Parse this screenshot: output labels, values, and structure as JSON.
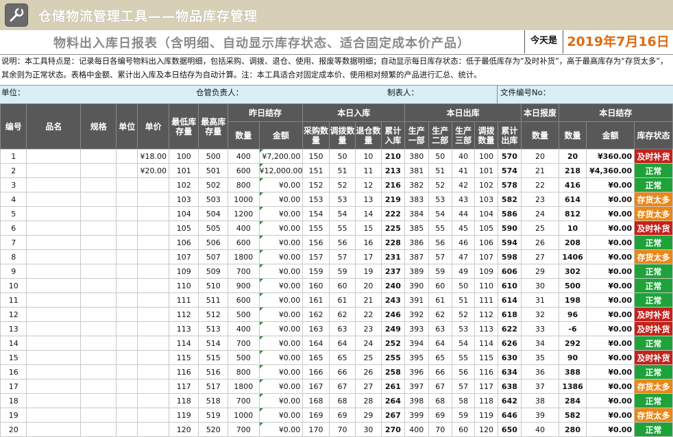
{
  "app": {
    "title": "仓储物流管理工具——物品库存管理",
    "icon": "wrench-icon"
  },
  "report": {
    "title": "物料出入库日报表（含明细、自动显示库存状态、适合固定成本价产品）",
    "today_label": "今天是",
    "today_value": "2019年7月16日"
  },
  "description": "说明：本工具特点是：记录每日各编号物料出入库数据明细，包括采购、调拨、退仓、使用、报废等数据明细；自动显示每日库存状态：低于最低库存为“及时补货”，高于最高库存为“存货太多”，其余则为正常状态。表格中金额、累计出入库及本日结存为自动计算。注：本工具适合对固定成本价、使用相对频繁的产品进行汇总、统计。",
  "info": {
    "unit": "单位：",
    "manager": "仓管负责人：",
    "maker": "制表人：",
    "doc_no": "文件编号No："
  },
  "headers": {
    "no": "编号",
    "name": "品名",
    "spec": "规格",
    "unit": "单位",
    "price": "单价",
    "min": "最低库存量",
    "max": "最高库存量",
    "yesterday": "昨日结存",
    "in": "本日入库",
    "out": "本日出库",
    "scrap": "本日报废",
    "today": "本日结存",
    "qty": "数量",
    "amount": "金额",
    "purchase": "采购数量",
    "transfer_in": "调拨数量",
    "return": "退仓数量",
    "in_total": "累计入库",
    "prod1": "生产一部",
    "prod2": "生产二部",
    "prod3": "生产三部",
    "transfer_out": "调拨数量",
    "out_total": "累计出库",
    "scrap_qty": "数量",
    "today_qty": "数量",
    "today_amount": "金额",
    "status": "库存状态"
  },
  "rows": [
    {
      "no": "1",
      "price": "¥18.00",
      "min": "100",
      "max": "500",
      "y_qty": "400",
      "y_amt": "¥7,200.00",
      "pur": "150",
      "tin": "50",
      "ret": "10",
      "in_tot": "210",
      "p1": "380",
      "p2": "50",
      "p3": "40",
      "tout": "100",
      "out_tot": "570",
      "scrap": "20",
      "t_qty": "20",
      "t_amt": "¥360.00",
      "status": "及时补货",
      "s": "low"
    },
    {
      "no": "2",
      "price": "¥20.00",
      "min": "101",
      "max": "501",
      "y_qty": "600",
      "y_amt": "¥12,000.00",
      "pur": "151",
      "tin": "51",
      "ret": "11",
      "in_tot": "213",
      "p1": "381",
      "p2": "51",
      "p3": "41",
      "tout": "101",
      "out_tot": "574",
      "scrap": "21",
      "t_qty": "218",
      "t_amt": "¥4,360.00",
      "status": "正常",
      "s": "ok"
    },
    {
      "no": "3",
      "price": "",
      "min": "102",
      "max": "502",
      "y_qty": "800",
      "y_amt": "¥0.00",
      "pur": "152",
      "tin": "52",
      "ret": "12",
      "in_tot": "216",
      "p1": "382",
      "p2": "52",
      "p3": "42",
      "tout": "102",
      "out_tot": "578",
      "scrap": "22",
      "t_qty": "416",
      "t_amt": "¥0.00",
      "status": "正常",
      "s": "ok"
    },
    {
      "no": "4",
      "price": "",
      "min": "103",
      "max": "503",
      "y_qty": "1000",
      "y_amt": "¥0.00",
      "pur": "153",
      "tin": "53",
      "ret": "13",
      "in_tot": "219",
      "p1": "383",
      "p2": "53",
      "p3": "43",
      "tout": "103",
      "out_tot": "582",
      "scrap": "23",
      "t_qty": "614",
      "t_amt": "¥0.00",
      "status": "存货太多",
      "s": "high"
    },
    {
      "no": "5",
      "price": "",
      "min": "104",
      "max": "504",
      "y_qty": "1200",
      "y_amt": "¥0.00",
      "pur": "154",
      "tin": "54",
      "ret": "14",
      "in_tot": "222",
      "p1": "384",
      "p2": "54",
      "p3": "44",
      "tout": "104",
      "out_tot": "586",
      "scrap": "24",
      "t_qty": "812",
      "t_amt": "¥0.00",
      "status": "存货太多",
      "s": "high"
    },
    {
      "no": "6",
      "price": "",
      "min": "105",
      "max": "505",
      "y_qty": "400",
      "y_amt": "¥0.00",
      "pur": "155",
      "tin": "55",
      "ret": "15",
      "in_tot": "225",
      "p1": "385",
      "p2": "55",
      "p3": "45",
      "tout": "105",
      "out_tot": "590",
      "scrap": "25",
      "t_qty": "10",
      "t_amt": "¥0.00",
      "status": "及时补货",
      "s": "low"
    },
    {
      "no": "7",
      "price": "",
      "min": "106",
      "max": "506",
      "y_qty": "600",
      "y_amt": "¥0.00",
      "pur": "156",
      "tin": "56",
      "ret": "16",
      "in_tot": "228",
      "p1": "386",
      "p2": "56",
      "p3": "46",
      "tout": "106",
      "out_tot": "594",
      "scrap": "26",
      "t_qty": "208",
      "t_amt": "¥0.00",
      "status": "正常",
      "s": "ok"
    },
    {
      "no": "8",
      "price": "",
      "min": "107",
      "max": "507",
      "y_qty": "1800",
      "y_amt": "¥0.00",
      "pur": "157",
      "tin": "57",
      "ret": "17",
      "in_tot": "231",
      "p1": "387",
      "p2": "57",
      "p3": "47",
      "tout": "107",
      "out_tot": "598",
      "scrap": "27",
      "t_qty": "1406",
      "t_amt": "¥0.00",
      "status": "存货太多",
      "s": "high"
    },
    {
      "no": "9",
      "price": "",
      "min": "109",
      "max": "509",
      "y_qty": "700",
      "y_amt": "¥0.00",
      "pur": "159",
      "tin": "59",
      "ret": "19",
      "in_tot": "237",
      "p1": "389",
      "p2": "59",
      "p3": "49",
      "tout": "109",
      "out_tot": "606",
      "scrap": "29",
      "t_qty": "302",
      "t_amt": "¥0.00",
      "status": "正常",
      "s": "ok"
    },
    {
      "no": "10",
      "price": "",
      "min": "110",
      "max": "510",
      "y_qty": "900",
      "y_amt": "¥0.00",
      "pur": "160",
      "tin": "60",
      "ret": "20",
      "in_tot": "240",
      "p1": "390",
      "p2": "60",
      "p3": "50",
      "tout": "110",
      "out_tot": "610",
      "scrap": "30",
      "t_qty": "500",
      "t_amt": "¥0.00",
      "status": "正常",
      "s": "ok"
    },
    {
      "no": "11",
      "price": "",
      "min": "111",
      "max": "511",
      "y_qty": "600",
      "y_amt": "¥0.00",
      "pur": "161",
      "tin": "61",
      "ret": "21",
      "in_tot": "243",
      "p1": "391",
      "p2": "61",
      "p3": "51",
      "tout": "111",
      "out_tot": "614",
      "scrap": "31",
      "t_qty": "198",
      "t_amt": "¥0.00",
      "status": "正常",
      "s": "ok"
    },
    {
      "no": "12",
      "price": "",
      "min": "112",
      "max": "512",
      "y_qty": "500",
      "y_amt": "¥0.00",
      "pur": "162",
      "tin": "62",
      "ret": "22",
      "in_tot": "246",
      "p1": "392",
      "p2": "62",
      "p3": "52",
      "tout": "112",
      "out_tot": "618",
      "scrap": "32",
      "t_qty": "96",
      "t_amt": "¥0.00",
      "status": "及时补货",
      "s": "low"
    },
    {
      "no": "13",
      "price": "",
      "min": "113",
      "max": "513",
      "y_qty": "400",
      "y_amt": "¥0.00",
      "pur": "163",
      "tin": "63",
      "ret": "23",
      "in_tot": "249",
      "p1": "393",
      "p2": "63",
      "p3": "53",
      "tout": "113",
      "out_tot": "622",
      "scrap": "33",
      "t_qty": "-6",
      "t_amt": "¥0.00",
      "status": "及时补货",
      "s": "low"
    },
    {
      "no": "14",
      "price": "",
      "min": "114",
      "max": "514",
      "y_qty": "700",
      "y_amt": "¥0.00",
      "pur": "164",
      "tin": "64",
      "ret": "24",
      "in_tot": "252",
      "p1": "394",
      "p2": "64",
      "p3": "54",
      "tout": "114",
      "out_tot": "626",
      "scrap": "34",
      "t_qty": "292",
      "t_amt": "¥0.00",
      "status": "正常",
      "s": "ok"
    },
    {
      "no": "15",
      "price": "",
      "min": "115",
      "max": "515",
      "y_qty": "500",
      "y_amt": "¥0.00",
      "pur": "165",
      "tin": "65",
      "ret": "25",
      "in_tot": "255",
      "p1": "395",
      "p2": "65",
      "p3": "55",
      "tout": "115",
      "out_tot": "630",
      "scrap": "35",
      "t_qty": "90",
      "t_amt": "¥0.00",
      "status": "及时补货",
      "s": "low"
    },
    {
      "no": "16",
      "price": "",
      "min": "116",
      "max": "516",
      "y_qty": "800",
      "y_amt": "¥0.00",
      "pur": "166",
      "tin": "66",
      "ret": "26",
      "in_tot": "258",
      "p1": "396",
      "p2": "66",
      "p3": "56",
      "tout": "116",
      "out_tot": "634",
      "scrap": "36",
      "t_qty": "388",
      "t_amt": "¥0.00",
      "status": "正常",
      "s": "ok"
    },
    {
      "no": "17",
      "price": "",
      "min": "117",
      "max": "517",
      "y_qty": "1800",
      "y_amt": "¥0.00",
      "pur": "167",
      "tin": "67",
      "ret": "27",
      "in_tot": "261",
      "p1": "397",
      "p2": "67",
      "p3": "57",
      "tout": "117",
      "out_tot": "638",
      "scrap": "37",
      "t_qty": "1386",
      "t_amt": "¥0.00",
      "status": "存货太多",
      "s": "high"
    },
    {
      "no": "18",
      "price": "",
      "min": "118",
      "max": "518",
      "y_qty": "700",
      "y_amt": "¥0.00",
      "pur": "168",
      "tin": "68",
      "ret": "28",
      "in_tot": "264",
      "p1": "398",
      "p2": "68",
      "p3": "58",
      "tout": "118",
      "out_tot": "642",
      "scrap": "38",
      "t_qty": "284",
      "t_amt": "¥0.00",
      "status": "正常",
      "s": "ok"
    },
    {
      "no": "19",
      "price": "",
      "min": "119",
      "max": "519",
      "y_qty": "1000",
      "y_amt": "¥0.00",
      "pur": "169",
      "tin": "69",
      "ret": "29",
      "in_tot": "267",
      "p1": "399",
      "p2": "69",
      "p3": "59",
      "tout": "119",
      "out_tot": "646",
      "scrap": "39",
      "t_qty": "582",
      "t_amt": "¥0.00",
      "status": "存货太多",
      "s": "high"
    },
    {
      "no": "20",
      "price": "",
      "min": "120",
      "max": "520",
      "y_qty": "700",
      "y_amt": "¥0.00",
      "pur": "170",
      "tin": "70",
      "ret": "30",
      "in_tot": "270",
      "p1": "400",
      "p2": "70",
      "p3": "60",
      "tout": "120",
      "out_tot": "650",
      "scrap": "40",
      "t_qty": "280",
      "t_amt": "¥0.00",
      "status": "正常",
      "s": "ok"
    }
  ],
  "colors": {
    "ok": "#1fa23a",
    "low": "#c4221c",
    "high": "#e98817",
    "header_bg": "#585858",
    "date": "#e06a10"
  }
}
